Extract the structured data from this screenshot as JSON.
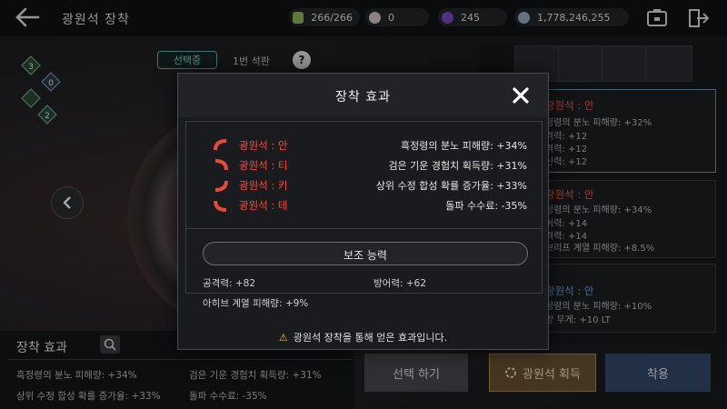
{
  "header": {
    "title": "광원석 장착",
    "currencies": [
      {
        "name": "stamina",
        "value": "266/266",
        "color": "#8fbf5a"
      },
      {
        "name": "pearl",
        "value": "0",
        "color": "#d8c8c8"
      },
      {
        "name": "purple-gem",
        "value": "245",
        "color": "#7a4ac8"
      },
      {
        "name": "silver",
        "value": "1,778,246,255",
        "color": "#9ab0c8"
      }
    ]
  },
  "left": {
    "tab_selected": "선택중",
    "tab_slot": "1번 석판",
    "help": "?",
    "stone_badges": [
      "3",
      "0",
      "2"
    ],
    "effects_title": "장착 효과",
    "effects": [
      "흑정령의 분노 피해량: +34%",
      "검은 기운 경험치 획득량: +31%",
      "상위 수정 합성 확률 증가율: +33%",
      "돌파 수수료: -35%"
    ]
  },
  "right": {
    "cards": [
      {
        "head": "광원석 : 안",
        "lines": [
          "정령의 분노 피해량: +32%",
          "격력: +12",
          "격력: +12",
          "신력: +12"
        ]
      },
      {
        "head": "광원석 : 안",
        "lines": [
          "정령의 분노 피해량: +34%",
          "어력: +14",
          "격력: +14",
          "브리프 계열 피해량: +8.5%"
        ]
      },
      {
        "head": "광원석 : 안",
        "lines": [
          "정령의 분노 피해량: +10%",
          "방 무게: +10 LT"
        ]
      }
    ],
    "btn_select": "선택 하기",
    "btn_acquire": "광원석 획득",
    "btn_apply": "착용"
  },
  "modal": {
    "title": "장착 효과",
    "close": "✕",
    "stones": [
      {
        "name": "광원석 : 안",
        "effect": "흑정령의 분노 피해량: +34%"
      },
      {
        "name": "광원석 : 티",
        "effect": "검은 기운 경험치 획득량: +31%"
      },
      {
        "name": "광원석 : 키",
        "effect": "상위 수정 합성 확률 증가율: +33%"
      },
      {
        "name": "광원석 : 테",
        "effect": "돌파 수수료: -35%"
      }
    ],
    "sub_title": "보조 능력",
    "stats": {
      "attack": "공격력: +82",
      "defense": "방어력: +62",
      "ahib": "아히브 계열 피해량: +9%"
    },
    "notice_icon": "⚠",
    "notice": "광원석 장착을 통해 얻은 효과입니다."
  }
}
